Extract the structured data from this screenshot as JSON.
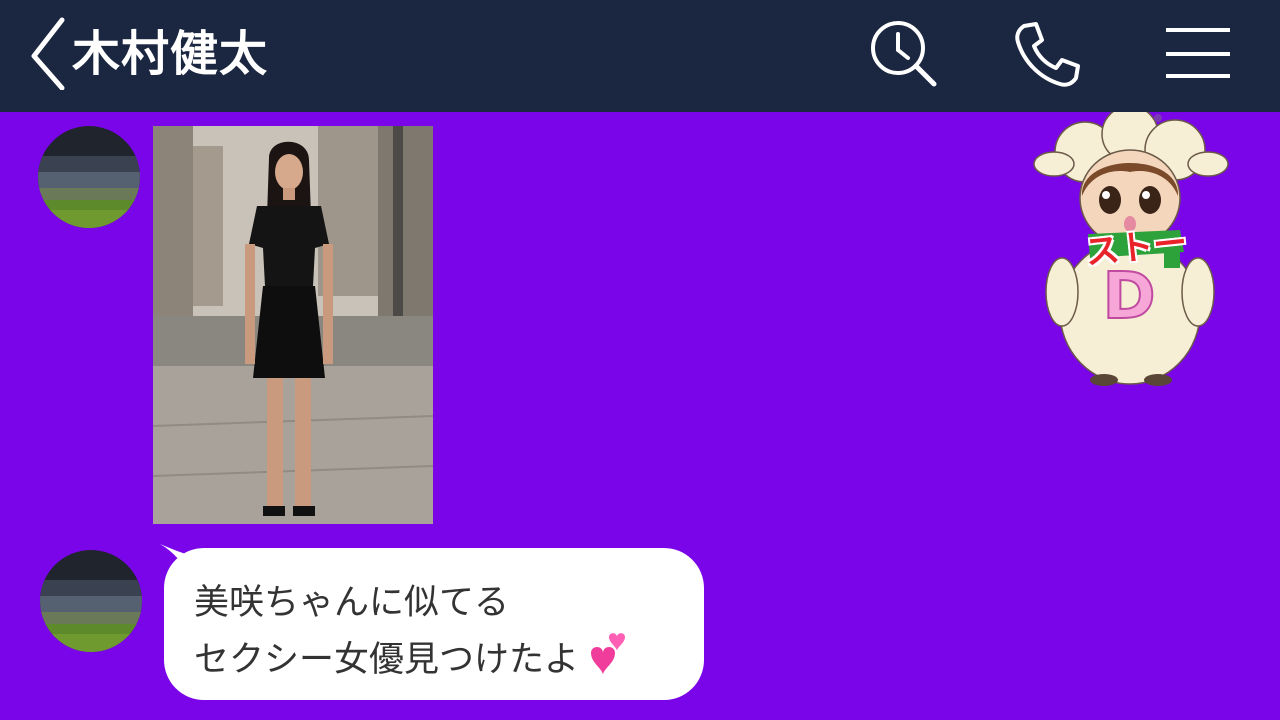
{
  "header": {
    "title": "木村健太",
    "icons": [
      "back-chevron-icon",
      "search-icon",
      "phone-icon",
      "menu-icon"
    ]
  },
  "messages": [
    {
      "type": "image",
      "description_icon": "photo-image"
    },
    {
      "type": "text",
      "lines": [
        "美咲ちゃんに似てる",
        "セクシー女優見つけたよ"
      ],
      "trailing_emoji": "hearts-icon"
    }
  ],
  "sticker": {
    "caption": "ストー",
    "letter": "D"
  },
  "colors": {
    "header_bg": "#1b2740",
    "chat_bg": "#7a05e9",
    "bubble_bg": "#ffffff",
    "bubble_text": "#333333"
  }
}
